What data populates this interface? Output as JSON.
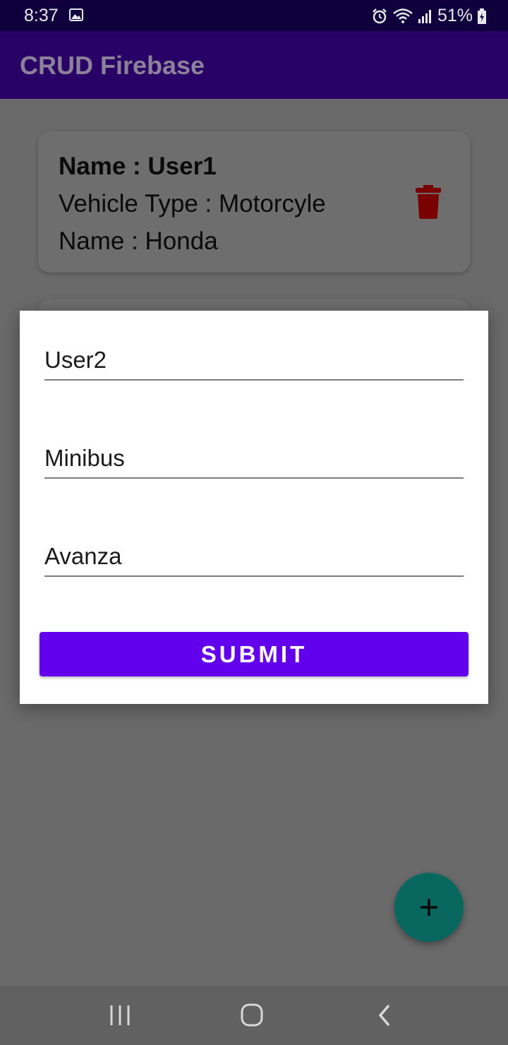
{
  "status_bar": {
    "time": "8:37",
    "battery": "51%",
    "icons": [
      "image-icon",
      "alarm-icon",
      "wifi-icon",
      "signal-icon",
      "battery-icon"
    ]
  },
  "app_bar": {
    "title": "CRUD Firebase"
  },
  "list": {
    "items": [
      {
        "name_line": "Name : User1",
        "vehicle_line": "Vehicle Type : Motorcyle",
        "brand_line": "Name : Honda"
      }
    ]
  },
  "dialog": {
    "fields": [
      {
        "value": "User2"
      },
      {
        "value": "Minibus"
      },
      {
        "value": "Avanza"
      }
    ],
    "submit_label": "SUBMIT"
  },
  "fab": {
    "icon": "plus-icon"
  },
  "nav_bar": {
    "icons": [
      "recents-icon",
      "home-icon",
      "back-icon"
    ]
  },
  "colors": {
    "app_bar": "#280066",
    "submit": "#6200ee",
    "fab": "#08685f",
    "delete_icon": "#7a0000",
    "scrim": "#6a6a6a"
  }
}
